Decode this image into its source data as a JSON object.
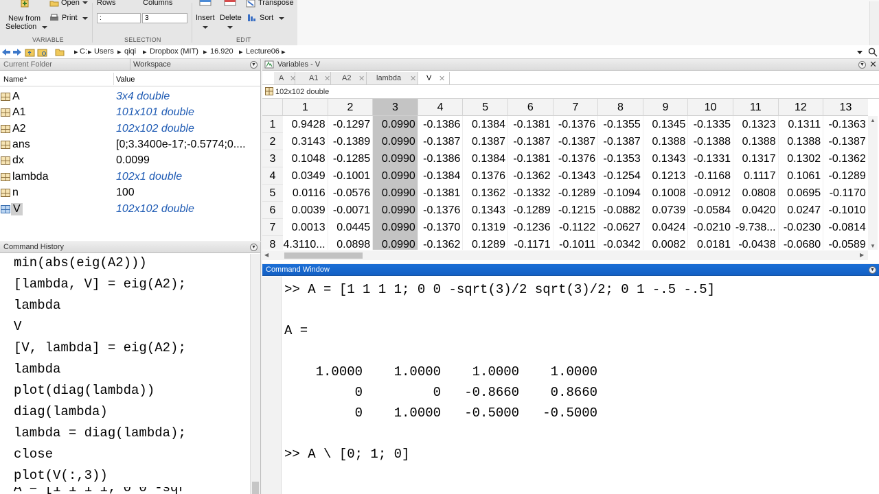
{
  "toolstrip": {
    "new_from_selection_label_1": "New from",
    "new_from_selection_label_2": "Selection",
    "open_label": "Open",
    "print_label": "Print",
    "rows_label": "Rows",
    "columns_label": "Columns",
    "rows_value": ":",
    "columns_value": "3",
    "insert_label": "Insert",
    "delete_label": "Delete",
    "transpose_label": "Transpose",
    "sort_label": "Sort",
    "group_variable": "VARIABLE",
    "group_selection": "SELECTION",
    "group_edit": "EDIT"
  },
  "address": {
    "crumbs": [
      "C:",
      "Users",
      "qiqi",
      "Dropbox (MIT)",
      "16.920",
      "Lecture06"
    ]
  },
  "current_folder_title": "Current Folder",
  "workspace": {
    "title": "Workspace",
    "col_name": "Name",
    "col_value": "Value",
    "rows": [
      {
        "name": "A",
        "value": "3x4 double",
        "style": "matrix"
      },
      {
        "name": "A1",
        "value": "101x101 double",
        "style": "matrix"
      },
      {
        "name": "A2",
        "value": "102x102 double",
        "style": "matrix"
      },
      {
        "name": "ans",
        "value": "[0;3.3400e-17;-0.5774;0....",
        "style": "plain"
      },
      {
        "name": "dx",
        "value": "0.0099",
        "style": "plain"
      },
      {
        "name": "lambda",
        "value": "102x1 double",
        "style": "matrix"
      },
      {
        "name": "n",
        "value": "100",
        "style": "plain"
      },
      {
        "name": "V",
        "value": "102x102 double",
        "style": "matrix"
      }
    ]
  },
  "history": {
    "title": "Command History",
    "lines": [
      "min(abs(eig(A2)))",
      "[lambda, V] = eig(A2);",
      "lambda",
      "V",
      "[V, lambda] = eig(A2);",
      "lambda",
      "plot(diag(lambda))",
      "diag(lambda)",
      "lambda = diag(lambda);",
      "close",
      "plot(V(:,3))",
      "A = [1 1 1 1; 0 0 -sqr"
    ]
  },
  "variables": {
    "title": "Variables - V",
    "tabs": [
      "A",
      "A1",
      "A2",
      "lambda",
      "V"
    ],
    "size_label": "102x102 double",
    "columns": [
      "1",
      "2",
      "3",
      "4",
      "5",
      "6",
      "7",
      "8",
      "9",
      "10",
      "11",
      "12",
      "13"
    ],
    "rows": [
      {
        "idx": "1",
        "cells": [
          "0.9428",
          "-0.1297",
          "0.0990",
          "-0.1386",
          "0.1384",
          "-0.1381",
          "-0.1376",
          "-0.1355",
          "0.1345",
          "-0.1335",
          "0.1323",
          "0.1311",
          "-0.1363"
        ]
      },
      {
        "idx": "2",
        "cells": [
          "0.3143",
          "-0.1389",
          "0.0990",
          "-0.1387",
          "0.1387",
          "-0.1387",
          "-0.1387",
          "-0.1387",
          "0.1388",
          "-0.1388",
          "0.1388",
          "0.1388",
          "-0.1387"
        ]
      },
      {
        "idx": "3",
        "cells": [
          "0.1048",
          "-0.1285",
          "0.0990",
          "-0.1386",
          "0.1384",
          "-0.1381",
          "-0.1376",
          "-0.1353",
          "0.1343",
          "-0.1331",
          "0.1317",
          "0.1302",
          "-0.1362"
        ]
      },
      {
        "idx": "4",
        "cells": [
          "0.0349",
          "-0.1001",
          "0.0990",
          "-0.1384",
          "0.1376",
          "-0.1362",
          "-0.1343",
          "-0.1254",
          "0.1213",
          "-0.1168",
          "0.1117",
          "0.1061",
          "-0.1289"
        ]
      },
      {
        "idx": "5",
        "cells": [
          "0.0116",
          "-0.0576",
          "0.0990",
          "-0.1381",
          "0.1362",
          "-0.1332",
          "-0.1289",
          "-0.1094",
          "0.1008",
          "-0.0912",
          "0.0808",
          "0.0695",
          "-0.1170"
        ]
      },
      {
        "idx": "6",
        "cells": [
          "0.0039",
          "-0.0071",
          "0.0990",
          "-0.1376",
          "0.1343",
          "-0.1289",
          "-0.1215",
          "-0.0882",
          "0.0739",
          "-0.0584",
          "0.0420",
          "0.0247",
          "-0.1010"
        ]
      },
      {
        "idx": "7",
        "cells": [
          "0.0013",
          "0.0445",
          "0.0990",
          "-0.1370",
          "0.1319",
          "-0.1236",
          "-0.1122",
          "-0.0627",
          "0.0424",
          "-0.0210",
          "-9.738...",
          "-0.0230",
          "-0.0814"
        ]
      },
      {
        "idx": "8",
        "cells": [
          "4.3110...",
          "0.0898",
          "0.0990",
          "-0.1362",
          "0.1289",
          "-0.1171",
          "-0.1011",
          "-0.0342",
          "0.0082",
          "0.0181",
          "-0.0438",
          "-0.0680",
          "-0.0589"
        ]
      }
    ]
  },
  "command_window": {
    "title": "Command Window",
    "lines": [
      ">> A = [1 1 1 1; 0 0 -sqrt(3)/2 sqrt(3)/2; 0 1 -.5 -.5]",
      "",
      "A =",
      "",
      "    1.0000    1.0000    1.0000    1.0000",
      "         0         0   -0.8660    0.8660",
      "         0    1.0000   -0.5000   -0.5000",
      "",
      ">> A \\ [0; 1; 0]"
    ]
  }
}
